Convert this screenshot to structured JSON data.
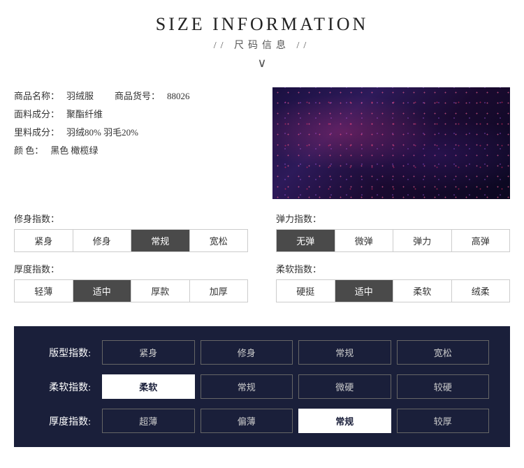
{
  "header": {
    "main_title": "SIZE INFORMATION",
    "sub_title": "//  尺码信息  //",
    "chevron": "∨"
  },
  "product": {
    "name_label": "商品名称：",
    "name_value": "羽绒服",
    "number_label": "商品货号：",
    "number_value": "88026",
    "fabric_label": "面料成分：",
    "fabric_value": "聚酯纤维",
    "lining_label": "里料成分：",
    "lining_value": "羽绒80% 羽毛20%",
    "color_label": "颜    色：",
    "color_value": "黑色 橄榄绿"
  },
  "fit_index": {
    "label": "修身指数：",
    "buttons": [
      "紧身",
      "修身",
      "常规",
      "宽松"
    ],
    "active": 2
  },
  "elasticity_index": {
    "label": "弹力指数：",
    "buttons": [
      "无弹",
      "微弹",
      "弹力",
      "高弹"
    ],
    "active": 0
  },
  "thickness_index": {
    "label": "厚度指数：",
    "buttons": [
      "轻薄",
      "适中",
      "厚款",
      "加厚"
    ],
    "active": 1
  },
  "softness_index": {
    "label": "柔软指数：",
    "buttons": [
      "硬挺",
      "适中",
      "柔软",
      "绒柔"
    ],
    "active": 1
  },
  "bottom_section": {
    "rows": [
      {
        "label": "版型指数:",
        "buttons": [
          "紧身",
          "修身",
          "常规",
          "宽松"
        ],
        "active": -1
      },
      {
        "label": "柔软指数:",
        "buttons": [
          "柔软",
          "常规",
          "微硬",
          "较硬"
        ],
        "active": 0
      },
      {
        "label": "厚度指数:",
        "buttons": [
          "超薄",
          "偏薄",
          "常规",
          "较厚"
        ],
        "active": 2
      }
    ]
  }
}
